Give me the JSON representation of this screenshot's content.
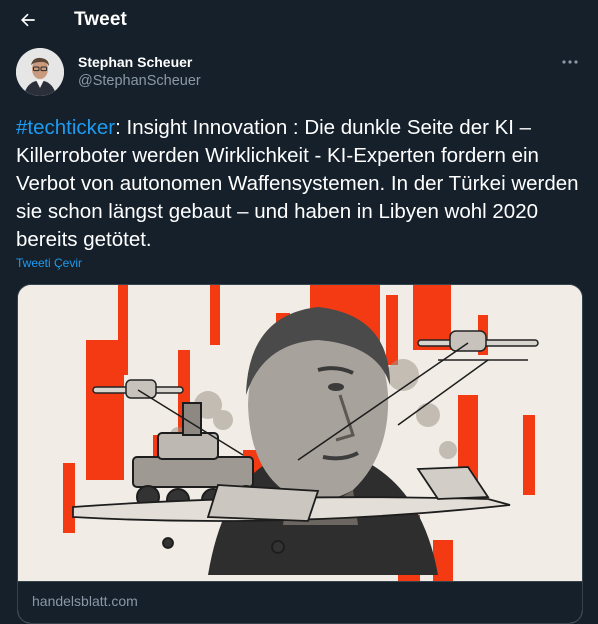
{
  "header": {
    "title": "Tweet",
    "back_icon": "arrow-left-icon"
  },
  "author": {
    "name": "Stephan Scheuer",
    "handle": "@StephanScheuer",
    "more_icon": "more-horizontal-icon"
  },
  "tweet": {
    "hashtag": "#techticker",
    "body": ": Insight Innovation : Die dunkle Seite der KI – Killerroboter werden Wirklichkeit - KI-Experten fordern ein Verbot von autonomen Waffensystemen. In der Türkei werden sie schon längst gebaut – und haben in Libyen wohl 2020 bereits getötet.",
    "translate_label": "Tweeti Çevir"
  },
  "card": {
    "domain": "handelsblatt.com"
  },
  "colors": {
    "background": "#15202b",
    "accent": "#1d9bf0",
    "secondary_text": "#8b98a5",
    "border": "#38444d",
    "illustration_red": "#f43a12"
  }
}
